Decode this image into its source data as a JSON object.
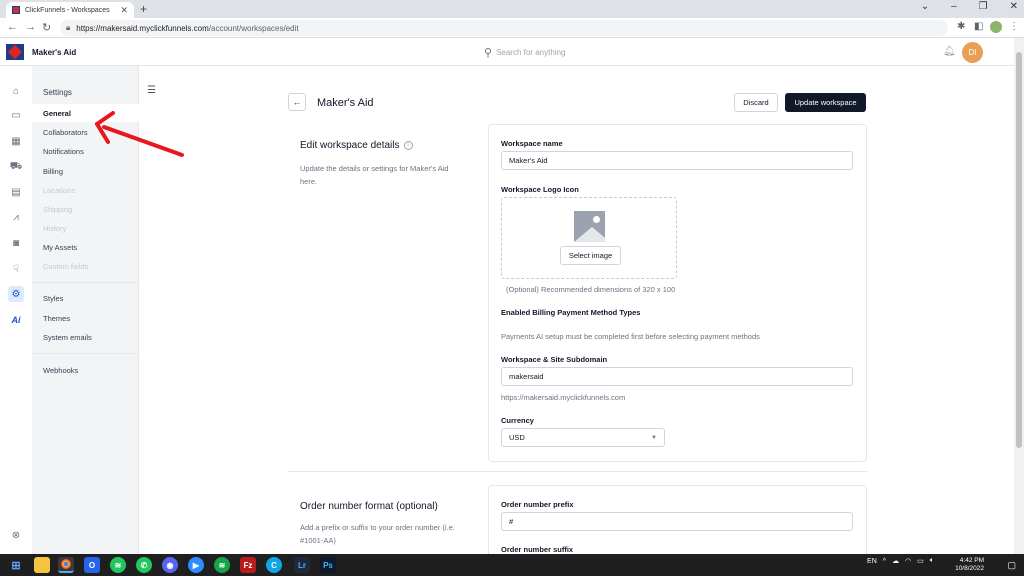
{
  "browser": {
    "tab_title": "ClickFunnels - Workspaces",
    "tab_close": "✕",
    "new_tab": "+",
    "url_host": "https://makersaid.myclickfunnels.com",
    "url_path": "/account/workspaces/edit"
  },
  "app": {
    "workspace_name": "Maker's Aid",
    "search_placeholder": "Search for anything",
    "avatar_initials": "DI"
  },
  "settings_nav": {
    "heading": "Settings",
    "items": [
      {
        "label": "General"
      },
      {
        "label": "Collaborators"
      },
      {
        "label": "Notifications"
      },
      {
        "label": "Billing"
      },
      {
        "label": "Locations"
      },
      {
        "label": "Shipping"
      },
      {
        "label": "History"
      },
      {
        "label": "My Assets"
      },
      {
        "label": "Custom fields"
      },
      {
        "label": "Styles"
      },
      {
        "label": "Themes"
      },
      {
        "label": "System emails"
      },
      {
        "label": "Webhooks"
      }
    ]
  },
  "header": {
    "title": "Maker's Aid",
    "discard_label": "Discard",
    "update_label": "Update workspace"
  },
  "workspace_details": {
    "title": "Edit workspace details",
    "description": "Update the details or settings for Maker's Aid here.",
    "name_label": "Workspace name",
    "name_value": "Maker's Aid",
    "logo_label": "Workspace Logo Icon",
    "select_image_label": "Select image",
    "logo_help": "(Optional) Recommended dimensions of 320 x 100",
    "billing_label": "Enabled Billing Payment Method Types",
    "billing_help": "Payments AI setup must be completed first before selecting payment methods",
    "subdomain_label": "Workspace & Site Subdomain",
    "subdomain_value": "makersaid",
    "subdomain_url": "https://makersaid.myclickfunnels.com",
    "currency_label": "Currency",
    "currency_value": "USD"
  },
  "order_format": {
    "title": "Order number format (optional)",
    "description": "Add a prefix or suffix to your order number (i.e. #1001-AA)",
    "prefix_label": "Order number prefix",
    "prefix_value": "#",
    "suffix_label": "Order number suffix"
  },
  "taskbar": {
    "lang": "EN",
    "time": "4:42 PM",
    "date": "10/8/2022"
  },
  "colors": {
    "annotation_arrow": "#e8161d",
    "primary_button": "#111827",
    "active_rail": "#1d4ed8",
    "avatar": "#e8a055"
  }
}
